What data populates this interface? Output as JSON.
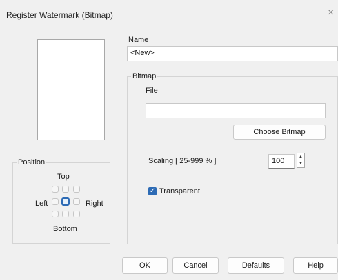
{
  "dialog": {
    "title": "Register Watermark (Bitmap)",
    "close_glyph": "×"
  },
  "name": {
    "label": "Name",
    "value": "<New>"
  },
  "position": {
    "label": "Position",
    "top": "Top",
    "left": "Left",
    "right": "Right",
    "bottom": "Bottom",
    "selected_cell": "center"
  },
  "bitmap": {
    "label": "Bitmap",
    "file_label": "File",
    "file_value": "",
    "choose_button": "Choose Bitmap",
    "scaling_label": "Scaling [ 25-999 % ]",
    "scaling_value": "100",
    "transparent_label": "Transparent",
    "transparent_checked": true
  },
  "buttons": {
    "ok": "OK",
    "cancel": "Cancel",
    "defaults": "Defaults",
    "help": "Help"
  },
  "colors": {
    "accent": "#2d6bb5",
    "background": "#f0f0f0"
  }
}
